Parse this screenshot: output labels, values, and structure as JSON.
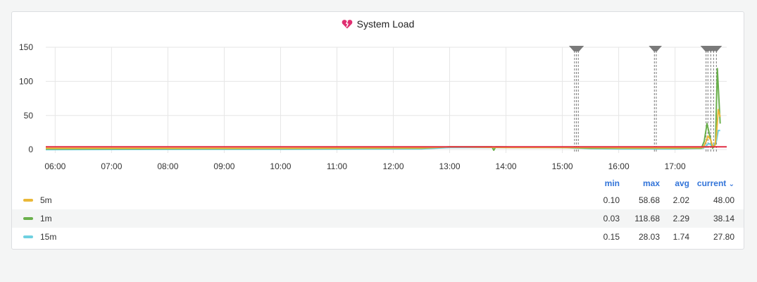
{
  "panel": {
    "title": "System Load",
    "icon": "broken-heart-icon",
    "icon_color": "#e02f71"
  },
  "legend": {
    "headers": {
      "min": "min",
      "max": "max",
      "avg": "avg",
      "current": "current"
    },
    "sort_icon": "chevron-down-icon",
    "rows": [
      {
        "name": "5m",
        "color": "#eab839",
        "min": "0.10",
        "max": "58.68",
        "avg": "2.02",
        "current": "48.00"
      },
      {
        "name": "1m",
        "color": "#6ab04c",
        "min": "0.03",
        "max": "118.68",
        "avg": "2.29",
        "current": "38.14"
      },
      {
        "name": "15m",
        "color": "#6ed0e0",
        "min": "0.15",
        "max": "28.03",
        "avg": "1.74",
        "current": "27.80"
      }
    ]
  },
  "chart_data": {
    "type": "line",
    "title": "System Load",
    "x_ticks": [
      "06:00",
      "07:00",
      "08:00",
      "09:00",
      "10:00",
      "11:00",
      "12:00",
      "13:00",
      "14:00",
      "15:00",
      "16:00",
      "17:00"
    ],
    "xlim": [
      "05:50",
      "17:55"
    ],
    "y_ticks": [
      0,
      50,
      100,
      150
    ],
    "ylim": [
      -5,
      150
    ],
    "grid": true,
    "legend_placement": "bottom",
    "threshold": {
      "value": 4,
      "color": "#e02f44"
    },
    "annotations": [
      "15:13",
      "15:15",
      "15:17",
      "16:38",
      "16:40",
      "17:33",
      "17:35",
      "17:38",
      "17:41",
      "17:44"
    ],
    "annotation_color": "#7a7a7a",
    "series": [
      {
        "name": "5m",
        "color": "#eab839",
        "points": [
          [
            "05:50",
            2
          ],
          [
            "10:00",
            2
          ],
          [
            "12:30",
            2.5
          ],
          [
            "13:00",
            4
          ],
          [
            "14:00",
            3
          ],
          [
            "15:00",
            3
          ],
          [
            "15:30",
            3
          ],
          [
            "16:00",
            2.5
          ],
          [
            "17:00",
            2.5
          ],
          [
            "17:30",
            3
          ],
          [
            "17:33",
            12
          ],
          [
            "17:35",
            20
          ],
          [
            "17:38",
            14
          ],
          [
            "17:40",
            5
          ],
          [
            "17:42",
            4
          ],
          [
            "17:44",
            20
          ],
          [
            "17:46",
            58.68
          ],
          [
            "17:48",
            48
          ]
        ]
      },
      {
        "name": "1m",
        "color": "#6ab04c",
        "points": [
          [
            "05:50",
            1
          ],
          [
            "10:00",
            1.5
          ],
          [
            "12:30",
            2
          ],
          [
            "13:00",
            4
          ],
          [
            "13:45",
            4
          ],
          [
            "13:47",
            -1
          ],
          [
            "13:49",
            4
          ],
          [
            "15:00",
            3
          ],
          [
            "15:30",
            2
          ],
          [
            "16:00",
            2
          ],
          [
            "17:00",
            2
          ],
          [
            "17:28",
            2
          ],
          [
            "17:31",
            12
          ],
          [
            "17:34",
            38
          ],
          [
            "17:37",
            20
          ],
          [
            "17:40",
            2
          ],
          [
            "17:43",
            8
          ],
          [
            "17:45",
            118.68
          ],
          [
            "17:48",
            38.14
          ]
        ]
      },
      {
        "name": "15m",
        "color": "#6ed0e0",
        "points": [
          [
            "05:50",
            0
          ],
          [
            "10:00",
            0.5
          ],
          [
            "12:30",
            1
          ],
          [
            "13:00",
            3
          ],
          [
            "15:00",
            3
          ],
          [
            "15:30",
            1.5
          ],
          [
            "16:00",
            1
          ],
          [
            "17:00",
            1
          ],
          [
            "17:30",
            2
          ],
          [
            "17:36",
            9
          ],
          [
            "17:40",
            5
          ],
          [
            "17:44",
            12
          ],
          [
            "17:46",
            28.03
          ],
          [
            "17:48",
            27.8
          ]
        ]
      }
    ]
  }
}
